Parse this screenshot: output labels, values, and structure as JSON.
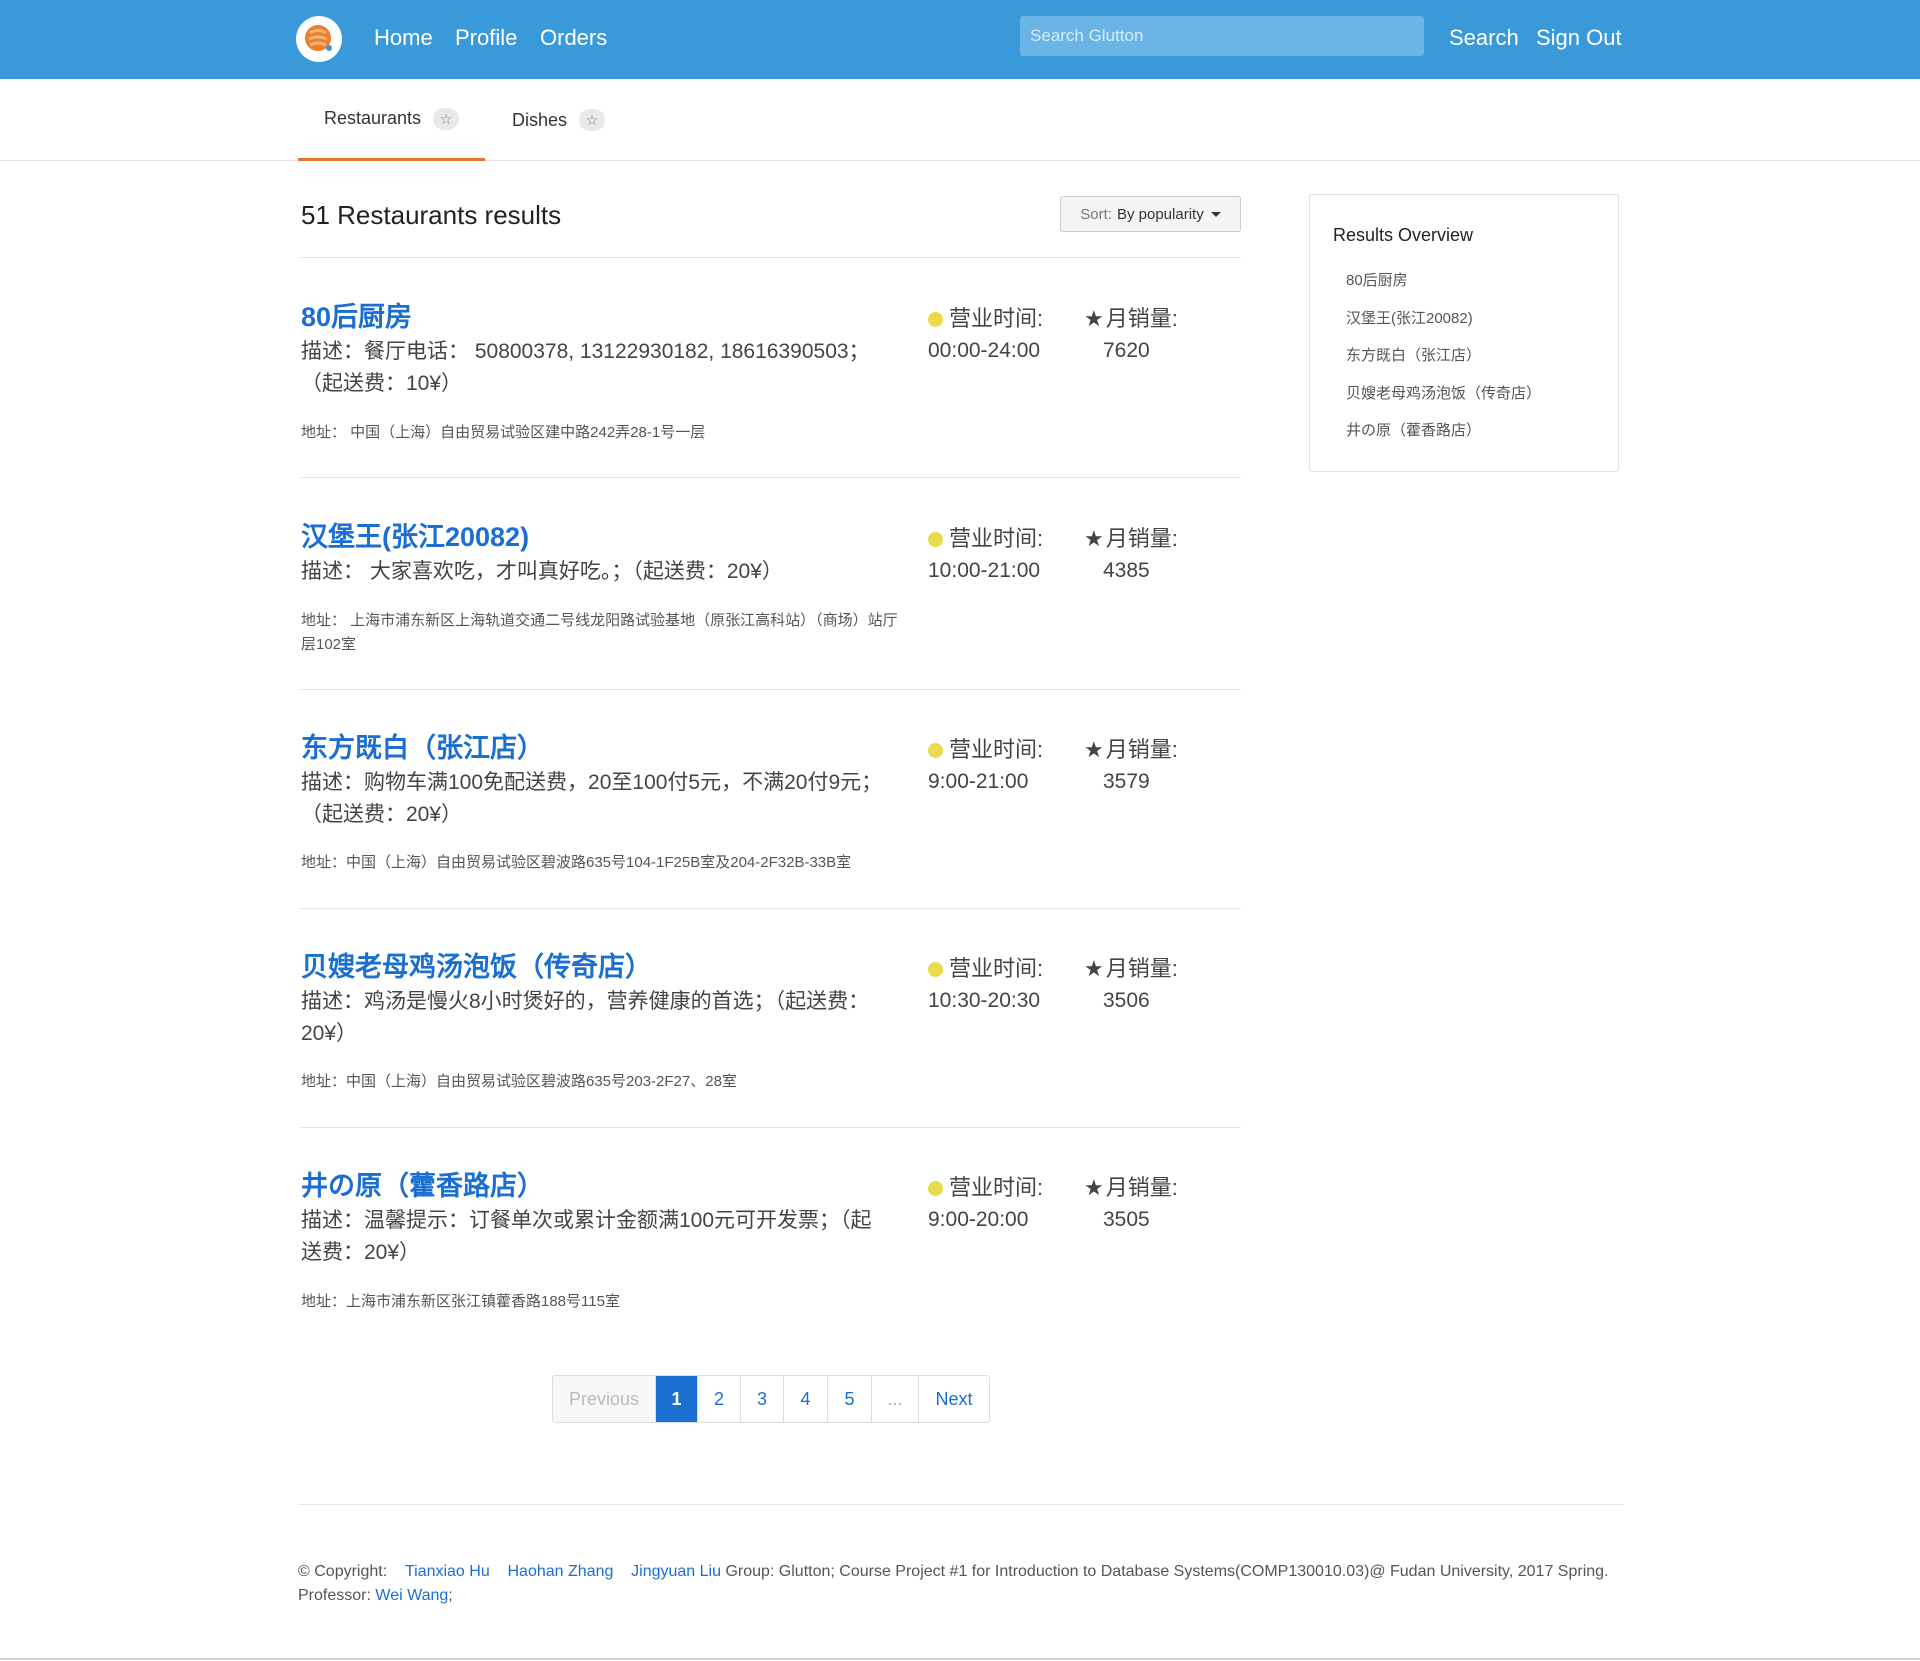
{
  "nav": {
    "links": [
      {
        "label": "Home"
      },
      {
        "label": "Profile"
      },
      {
        "label": "Orders"
      }
    ],
    "search_placeholder": "Search Glutton",
    "search_label": "Search",
    "signout_label": "Sign Out"
  },
  "tabs": [
    {
      "label": "Restaurants",
      "badge": "☆",
      "active": true
    },
    {
      "label": "Dishes",
      "badge": "☆",
      "active": false
    }
  ],
  "results": {
    "title": "51 Restaurants results",
    "sort_prefix": "Sort:",
    "sort_value": "By popularity"
  },
  "restaurants": [
    {
      "name": "80后厨房",
      "description": "描述：餐厅电话： 50800378, 13122930182, 18616390503；（起送费：10¥）",
      "address": "地址： 中国（上海）自由贸易试验区建中路242弄28-1号一层",
      "hours_label": "营业时间:",
      "hours": "00:00-24:00",
      "sales_label": "月销量:",
      "sales": "7620"
    },
    {
      "name": "汉堡王(张江20082)",
      "description": "描述： 大家喜欢吃，才叫真好吃。；（起送费：20¥）",
      "address": "地址： 上海市浦东新区上海轨道交通二号线龙阳路试验基地（原张江高科站）（商场）站厅层102室",
      "hours_label": "营业时间:",
      "hours": "10:00-21:00",
      "sales_label": "月销量:",
      "sales": "4385"
    },
    {
      "name": "东方既白（张江店）",
      "description": "描述：购物车满100免配送费，20至100付5元，不满20付9元；（起送费：20¥）",
      "address": "地址：中国（上海）自由贸易试验区碧波路635号104-1F25B室及204-2F32B-33B室",
      "hours_label": "营业时间:",
      "hours": "9:00-21:00",
      "sales_label": "月销量:",
      "sales": "3579"
    },
    {
      "name": "贝嫂老母鸡汤泡饭（传奇店）",
      "description": "描述：鸡汤是慢火8小时煲好的，营养健康的首选；（起送费：20¥）",
      "address": "地址：中国（上海）自由贸易试验区碧波路635号203-2F27、28室",
      "hours_label": "营业时间:",
      "hours": "10:30-20:30",
      "sales_label": "月销量:",
      "sales": "3506"
    },
    {
      "name": "井の原（藿香路店）",
      "description": "描述：温馨提示：订餐单次或累计金额满100元可开发票；（起送费：20¥）",
      "address": "地址：上海市浦东新区张江镇藿香路188号115室",
      "hours_label": "营业时间:",
      "hours": "9:00-20:00",
      "sales_label": "月销量:",
      "sales": "3505"
    }
  ],
  "pagination": {
    "previous": "Previous",
    "pages": [
      "1",
      "2",
      "3",
      "4",
      "5"
    ],
    "ellipsis": "...",
    "next": "Next",
    "current": "1"
  },
  "sidebar": {
    "title": "Results Overview",
    "items": [
      "80后厨房",
      "汉堡王(张江20082)",
      "东方既白（张江店）",
      "贝嫂老母鸡汤泡饭（传奇店）",
      "井の原（藿香路店）"
    ]
  },
  "footer": {
    "copyright": "© Copyright:",
    "authors": [
      "Tianxiao Hu",
      "Haohan Zhang",
      "Jingyuan Liu"
    ],
    "group_text": "Group: Glutton; Course Project #1 for Introduction to Database Systems(COMP130010.03)@ Fudan University, 2017 Spring.",
    "professor_label": "Professor:",
    "professor": "Wei Wang",
    "professor_suffix": ";"
  },
  "colors": {
    "navbar": "#3a9ad9",
    "link": "#1a6fd1",
    "tab_accent": "#e8742a",
    "status_dot": "#e8dc4c"
  }
}
